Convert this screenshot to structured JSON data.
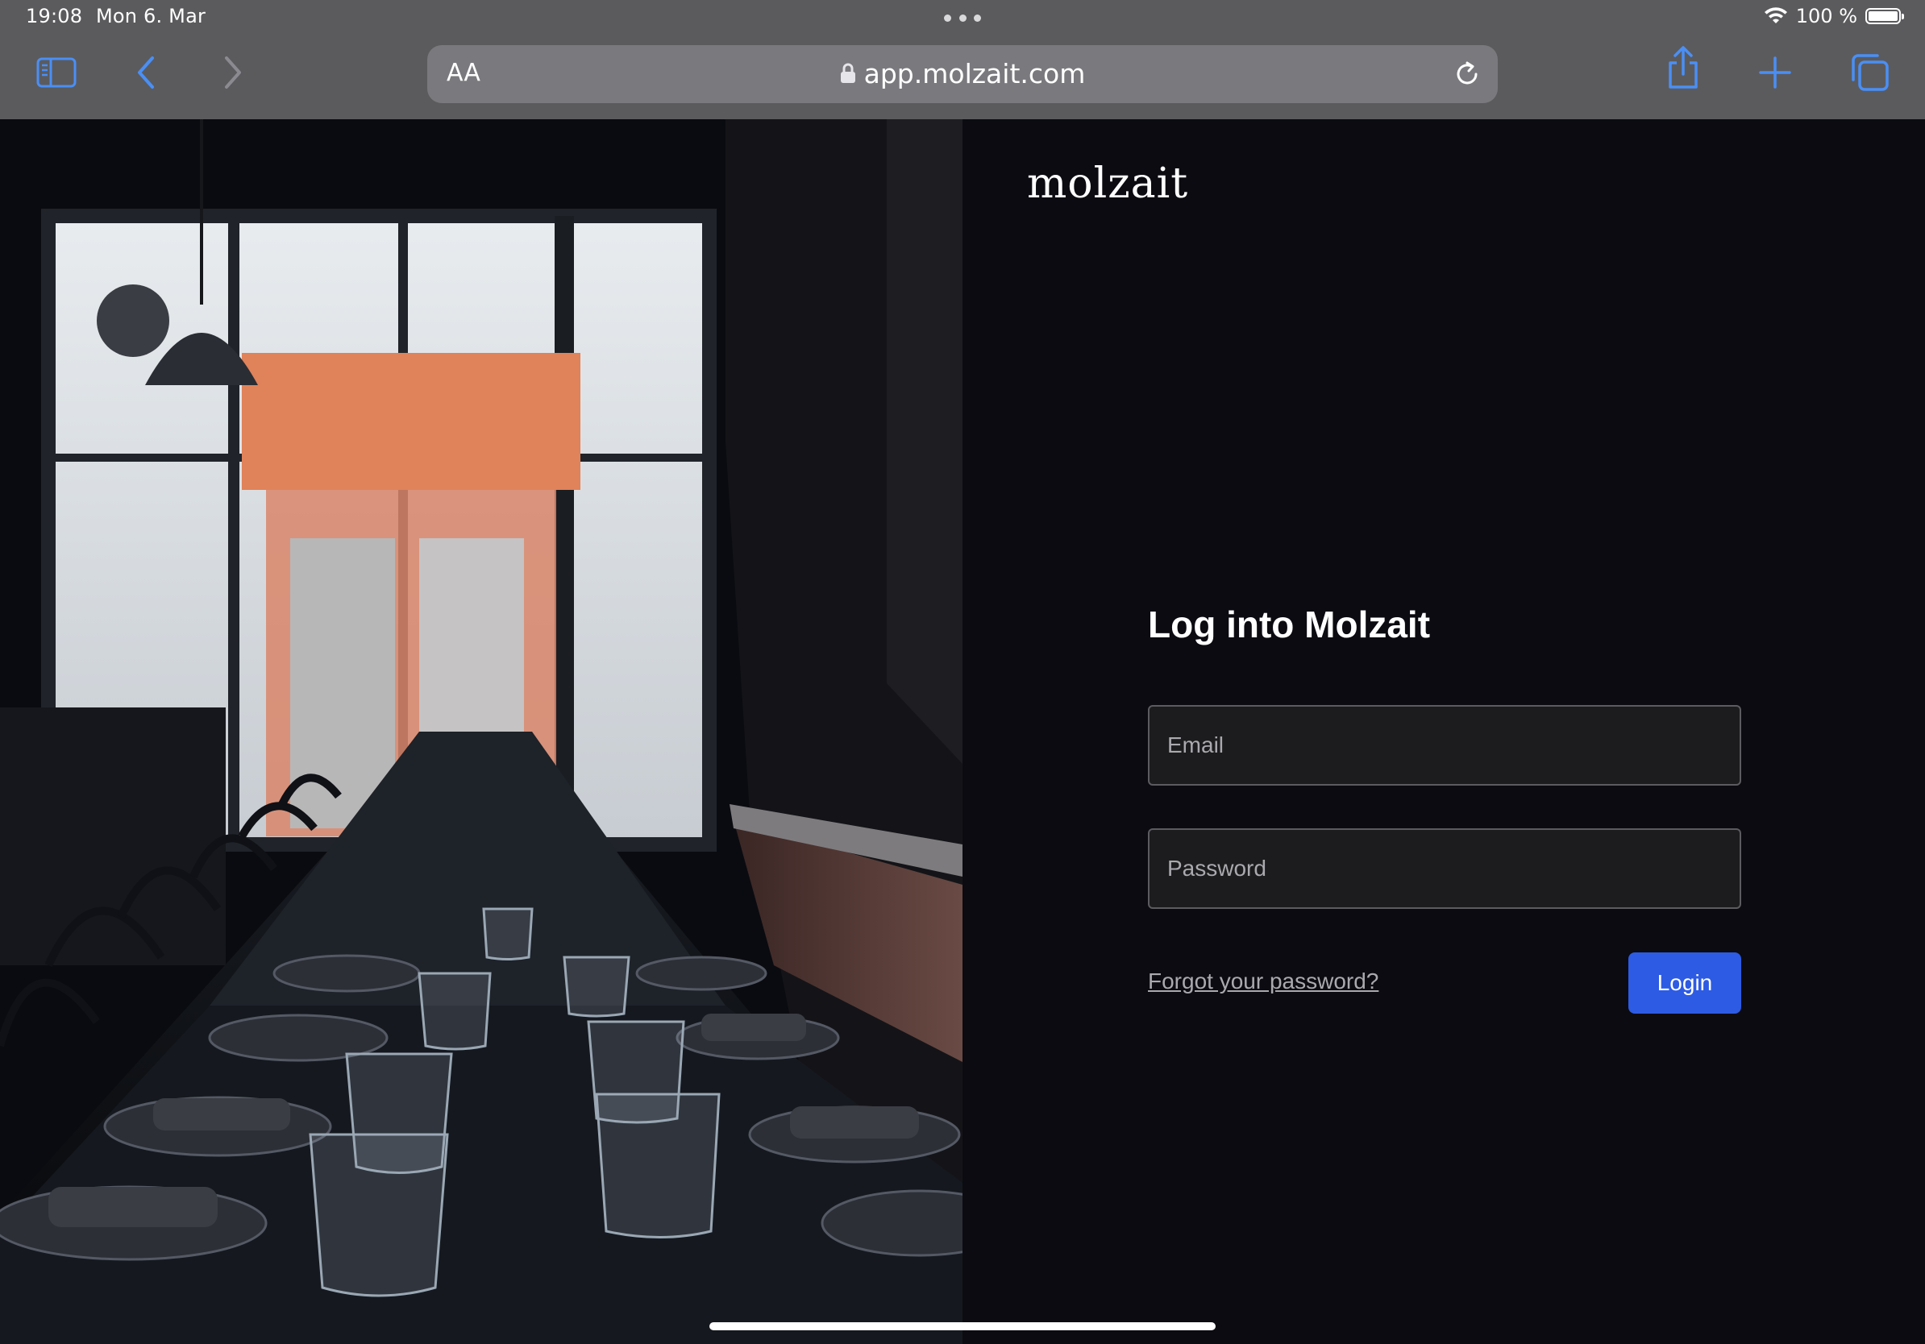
{
  "status_bar": {
    "time": "19:08",
    "date": "Mon 6. Mar",
    "battery_text": "100 %"
  },
  "browser": {
    "text_size_label": "AA",
    "url": "app.molzait.com"
  },
  "brand": {
    "name": "molzait"
  },
  "login": {
    "title": "Log into Molzait",
    "email_placeholder": "Email",
    "password_placeholder": "Password",
    "forgot_link": "Forgot your password?",
    "login_button": "Login"
  },
  "colors": {
    "accent": "#2d5be3",
    "panel_bg": "#0b0b11",
    "chrome_bg": "#5b5b5e",
    "ios_blue": "#4a8ff5"
  },
  "icons": {
    "sidebar": "sidebar-icon",
    "back": "chevron-left-icon",
    "forward": "chevron-right-icon",
    "lock": "lock-icon",
    "reload": "reload-icon",
    "share": "share-icon",
    "new_tab": "plus-icon",
    "tabs": "tabs-icon",
    "wifi": "wifi-icon",
    "battery": "battery-icon"
  }
}
